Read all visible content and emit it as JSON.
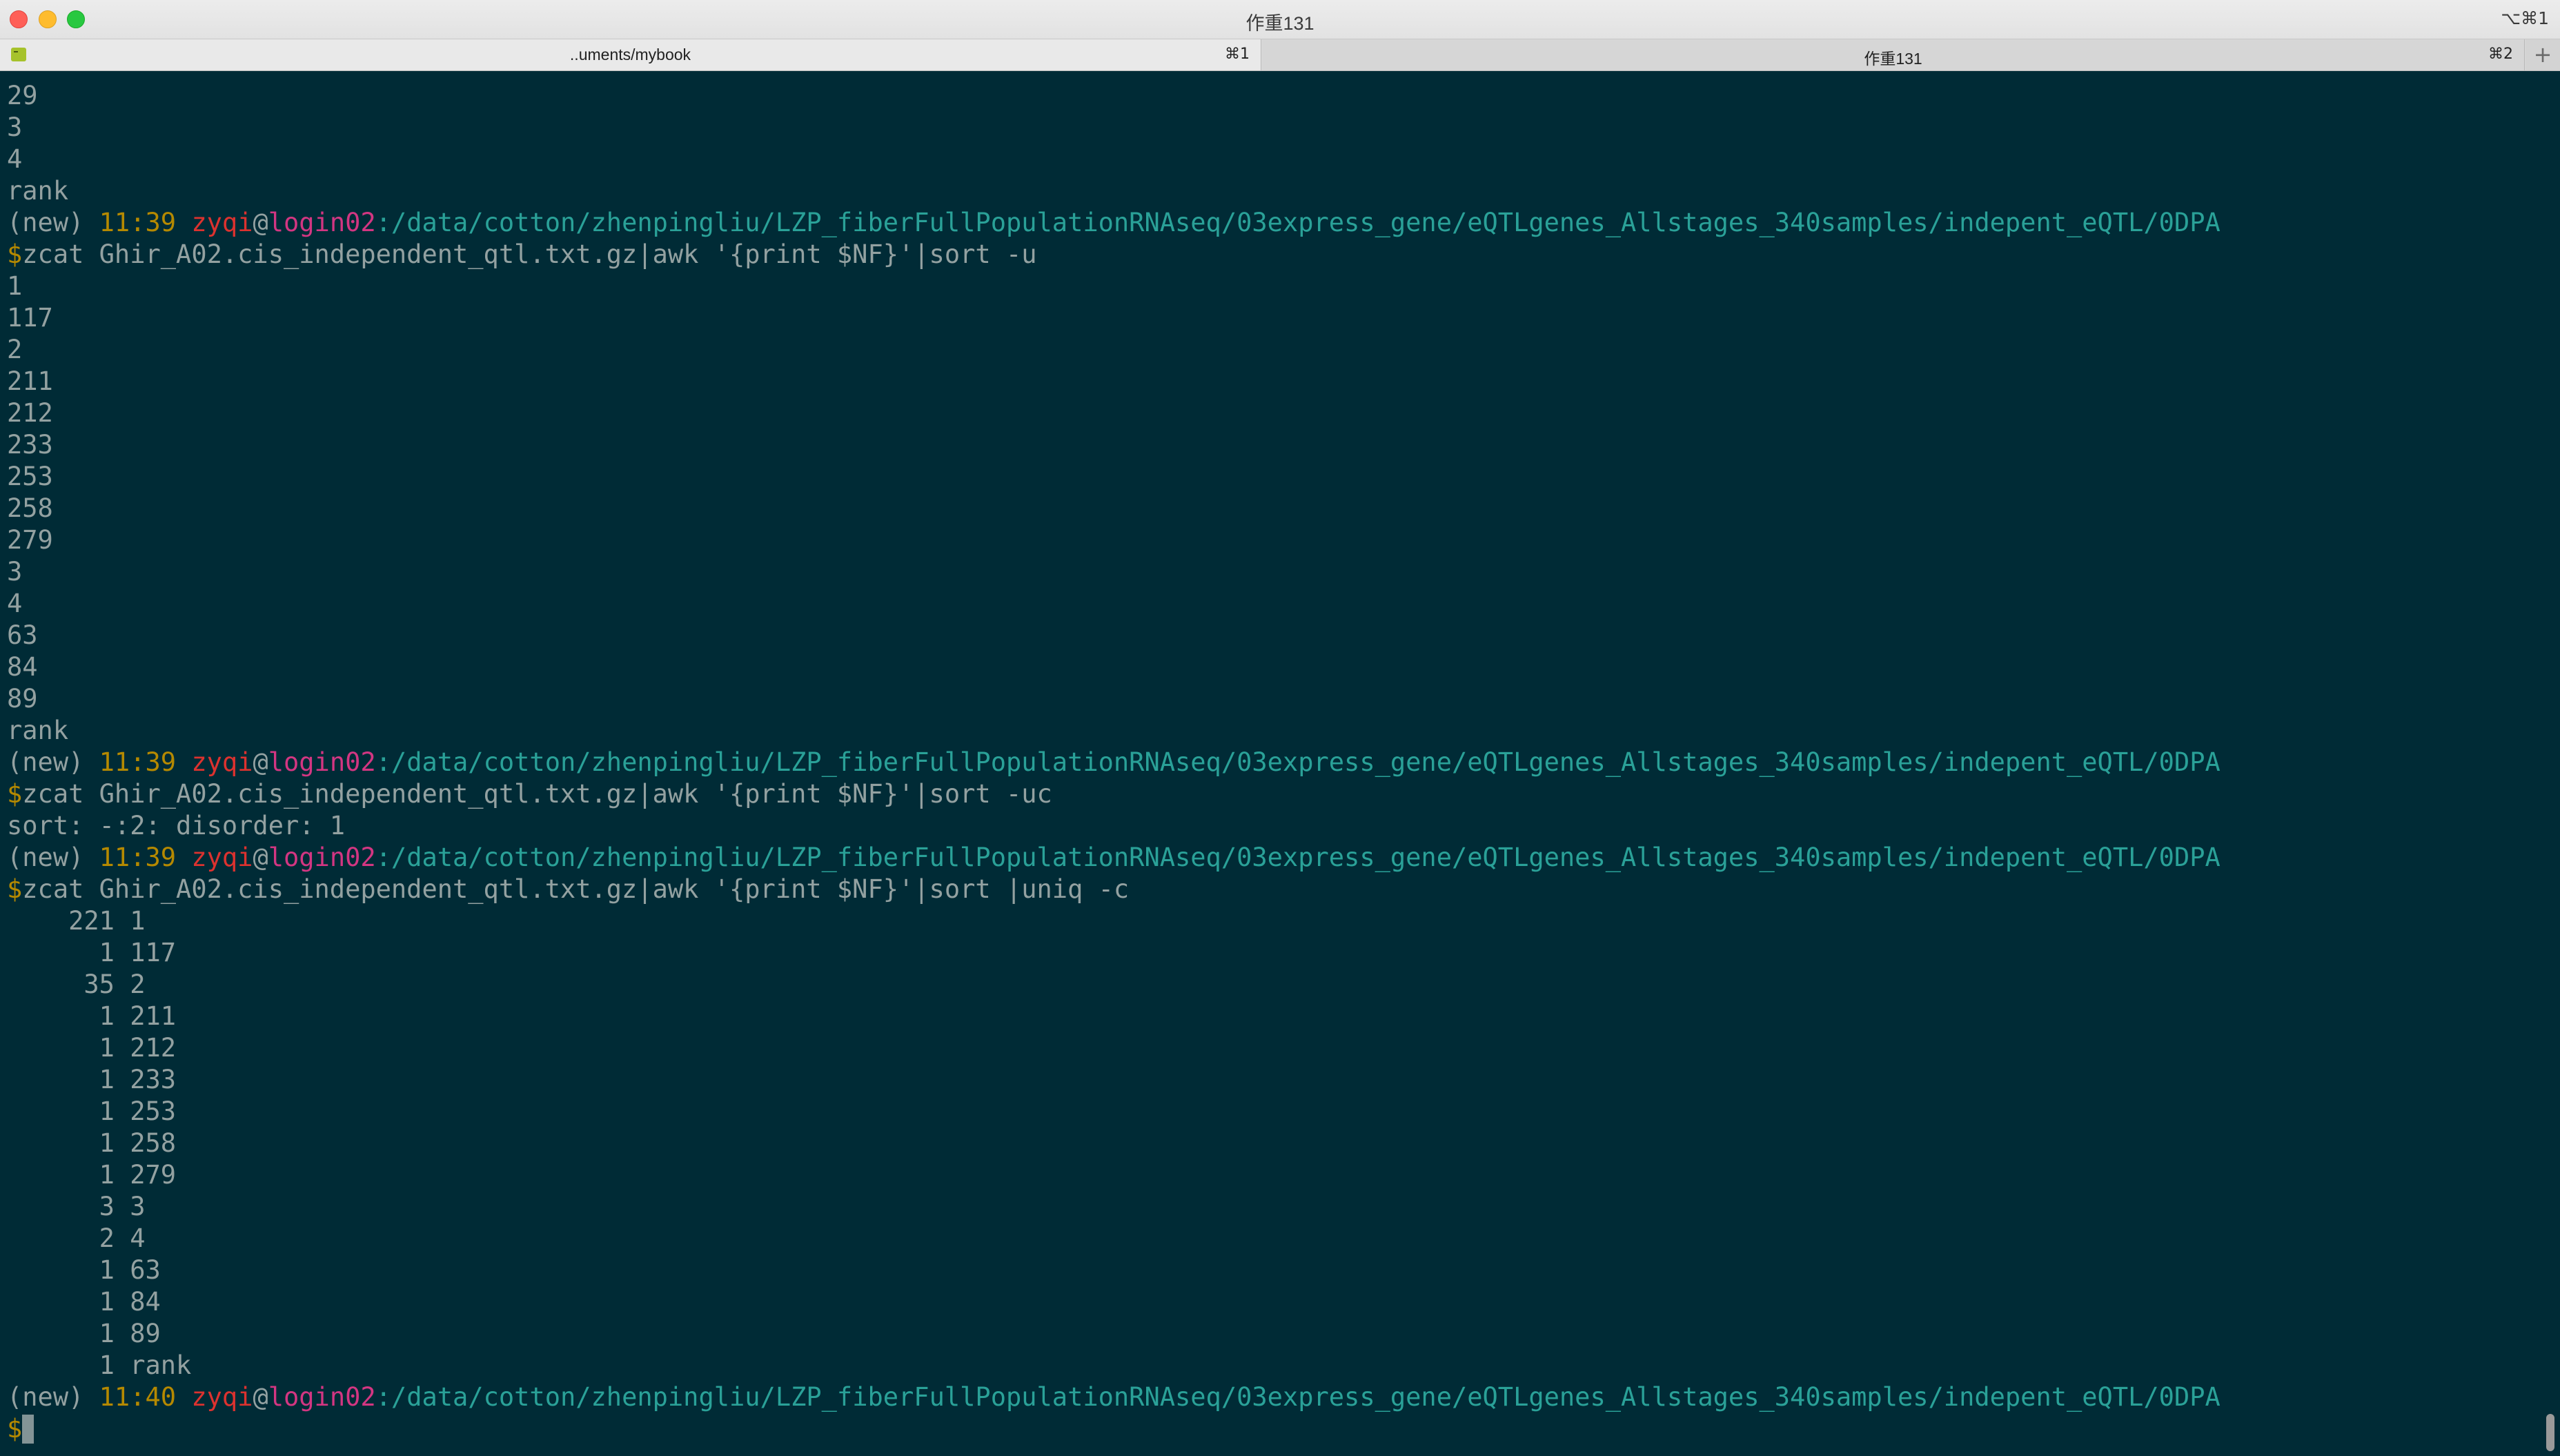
{
  "window": {
    "title": "作重131",
    "shortcut": "⌥⌘1"
  },
  "tabs": [
    {
      "label": "..uments/mybook",
      "shortcut": "⌘1"
    },
    {
      "label": "作重131",
      "shortcut": "⌘2"
    }
  ],
  "new_tab_label": "+",
  "prompt": {
    "env": "(new) ",
    "user": "zyqi",
    "at": "@",
    "host": "login02",
    "path": ":/data/cotton/zhenpingliu/LZP_fiberFullPopulationRNAseq/03express_gene/eQTLgenes_Allstages_340samples/indepent_eQTL/0DPA",
    "dollar": "$"
  },
  "terminal_lines": [
    {
      "kind": "out",
      "text": "29"
    },
    {
      "kind": "out",
      "text": "3"
    },
    {
      "kind": "out",
      "text": "4"
    },
    {
      "kind": "out",
      "text": "rank"
    },
    {
      "kind": "prompt",
      "time": "11:39"
    },
    {
      "kind": "cmd",
      "text": "zcat Ghir_A02.cis_independent_qtl.txt.gz|awk '{print $NF}'|sort -u"
    },
    {
      "kind": "out",
      "text": "1"
    },
    {
      "kind": "out",
      "text": "117"
    },
    {
      "kind": "out",
      "text": "2"
    },
    {
      "kind": "out",
      "text": "211"
    },
    {
      "kind": "out",
      "text": "212"
    },
    {
      "kind": "out",
      "text": "233"
    },
    {
      "kind": "out",
      "text": "253"
    },
    {
      "kind": "out",
      "text": "258"
    },
    {
      "kind": "out",
      "text": "279"
    },
    {
      "kind": "out",
      "text": "3"
    },
    {
      "kind": "out",
      "text": "4"
    },
    {
      "kind": "out",
      "text": "63"
    },
    {
      "kind": "out",
      "text": "84"
    },
    {
      "kind": "out",
      "text": "89"
    },
    {
      "kind": "out",
      "text": "rank"
    },
    {
      "kind": "prompt",
      "time": "11:39"
    },
    {
      "kind": "cmd",
      "text": "zcat Ghir_A02.cis_independent_qtl.txt.gz|awk '{print $NF}'|sort -uc"
    },
    {
      "kind": "out",
      "text": "sort: -:2: disorder: 1"
    },
    {
      "kind": "prompt",
      "time": "11:39"
    },
    {
      "kind": "cmd",
      "text": "zcat Ghir_A02.cis_independent_qtl.txt.gz|awk '{print $NF}'|sort |uniq -c"
    },
    {
      "kind": "out",
      "text": "    221 1"
    },
    {
      "kind": "out",
      "text": "      1 117"
    },
    {
      "kind": "out",
      "text": "     35 2"
    },
    {
      "kind": "out",
      "text": "      1 211"
    },
    {
      "kind": "out",
      "text": "      1 212"
    },
    {
      "kind": "out",
      "text": "      1 233"
    },
    {
      "kind": "out",
      "text": "      1 253"
    },
    {
      "kind": "out",
      "text": "      1 258"
    },
    {
      "kind": "out",
      "text": "      1 279"
    },
    {
      "kind": "out",
      "text": "      3 3"
    },
    {
      "kind": "out",
      "text": "      2 4"
    },
    {
      "kind": "out",
      "text": "      1 63"
    },
    {
      "kind": "out",
      "text": "      1 84"
    },
    {
      "kind": "out",
      "text": "      1 89"
    },
    {
      "kind": "out",
      "text": "      1 rank"
    },
    {
      "kind": "prompt",
      "time": "11:40"
    },
    {
      "kind": "input",
      "text": ""
    }
  ]
}
